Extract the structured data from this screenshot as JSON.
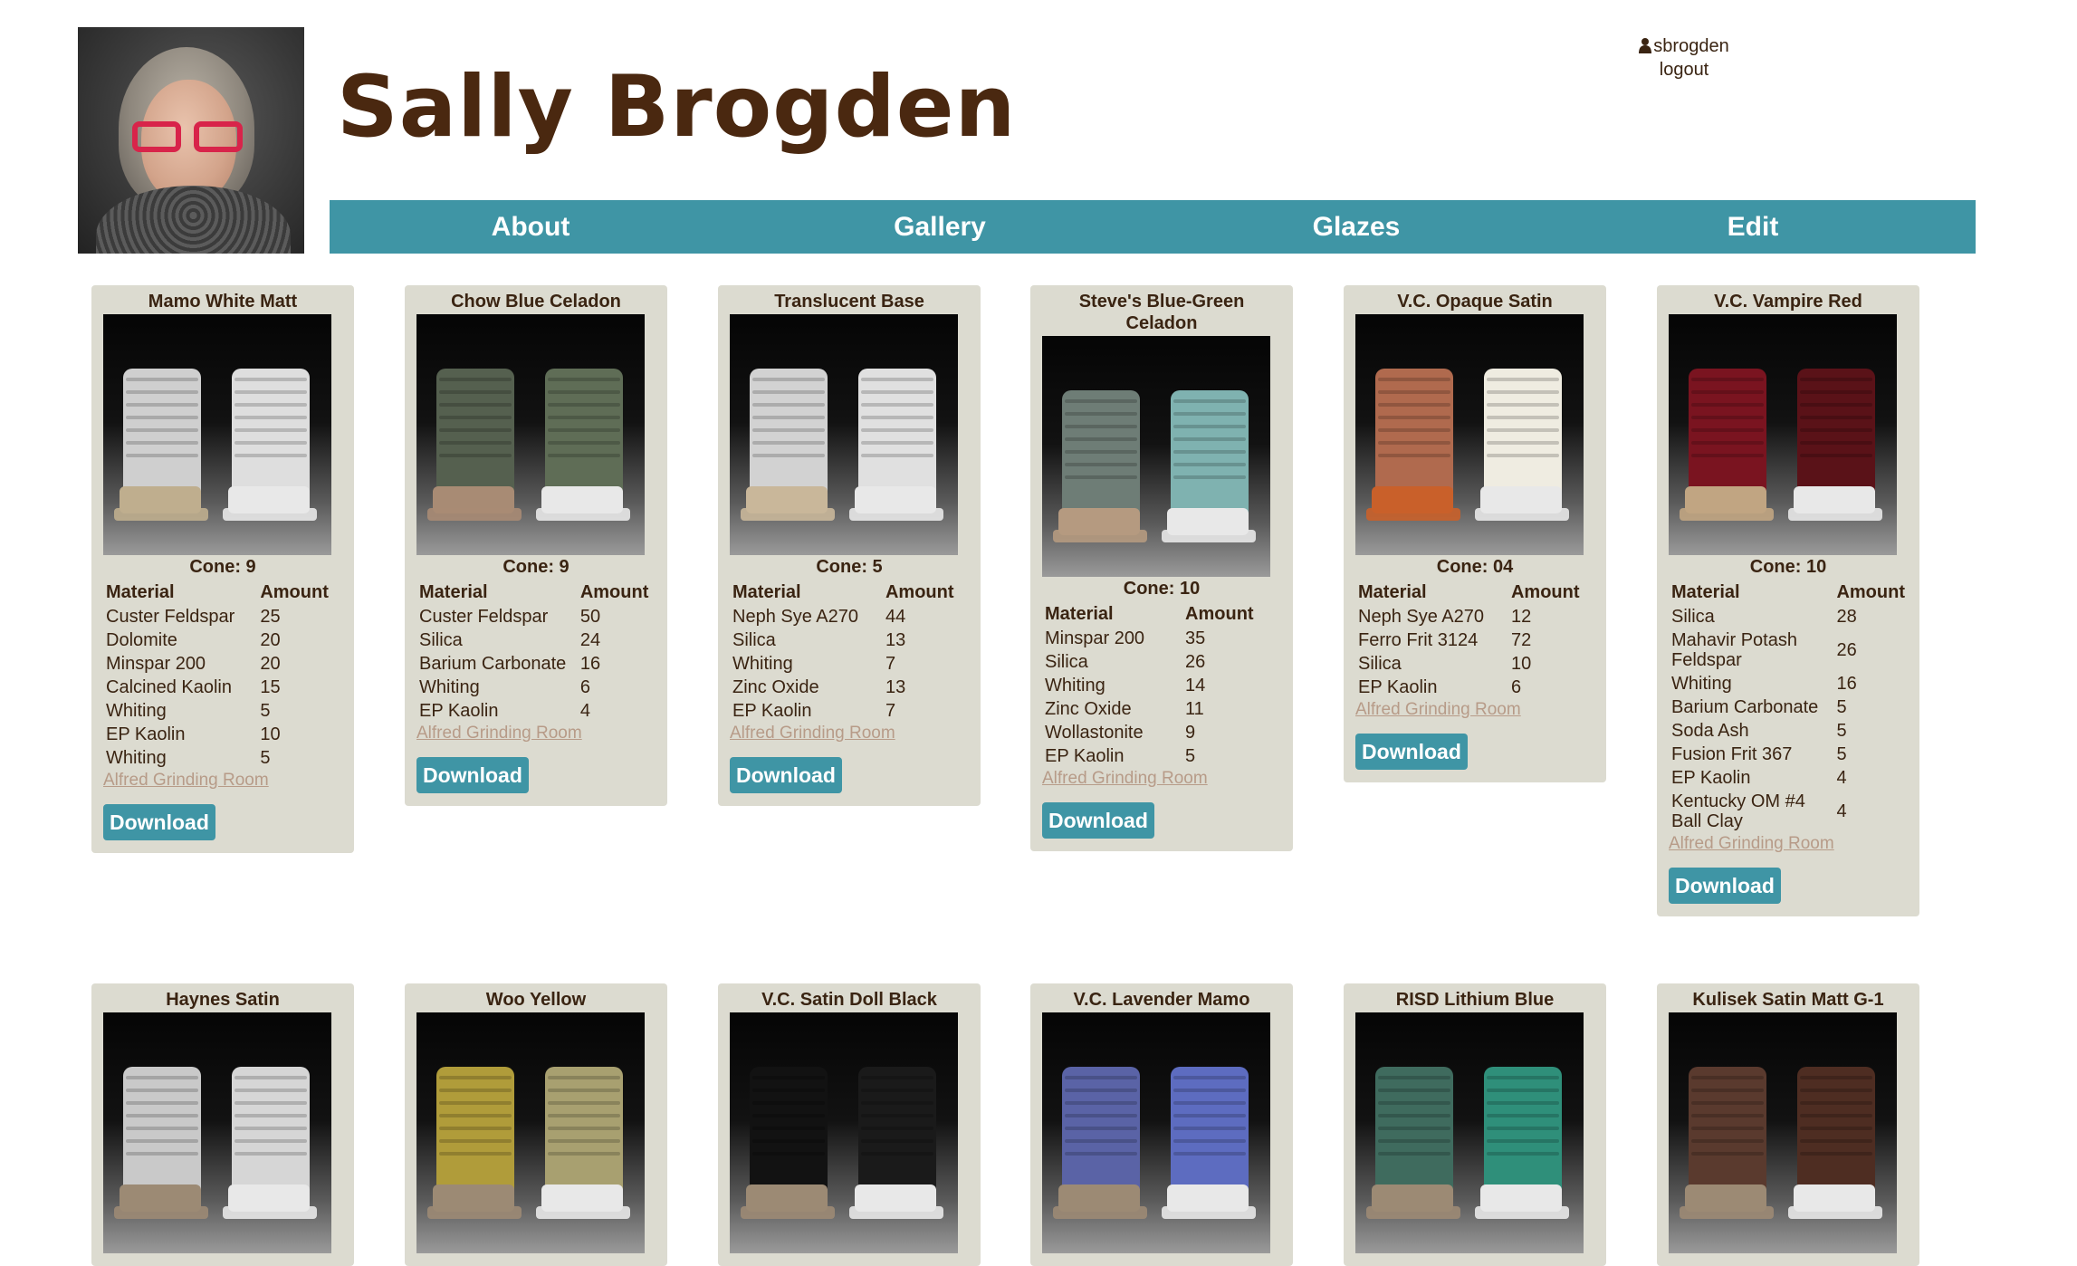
{
  "header": {
    "site_title": "Sally Brogden",
    "username": "sbrogden",
    "logout_label": "logout"
  },
  "nav": {
    "items": [
      "About",
      "Gallery",
      "Glazes",
      "Edit"
    ]
  },
  "colors": {
    "brand": "#4a2810",
    "nav_bg": "#3f95a5",
    "card_bg": "#dcdbd0",
    "link_muted": "#b79b88"
  },
  "labels": {
    "material": "Material",
    "amount": "Amount",
    "download": "Download"
  },
  "cards": [
    {
      "name": "Mamo White Matt",
      "cone": "Cone: 9",
      "swatch": [
        "#cfcfcf",
        "#dedede"
      ],
      "base": "#bfae8e",
      "rows": [
        [
          "Custer Feldspar",
          "25"
        ],
        [
          "Dolomite",
          "20"
        ],
        [
          "Minspar 200",
          "20"
        ],
        [
          "Calcined Kaolin",
          "15"
        ],
        [
          "Whiting",
          "5"
        ],
        [
          "EP Kaolin",
          "10"
        ],
        [
          "Whiting",
          "5"
        ]
      ],
      "source": "Alfred Grinding Room"
    },
    {
      "name": "Chow Blue Celadon",
      "cone": "Cone: 9",
      "swatch": [
        "#55604f",
        "#5f6d56"
      ],
      "base": "#a88b74",
      "rows": [
        [
          "Custer Feldspar",
          "50"
        ],
        [
          "Silica",
          "24"
        ],
        [
          "Barium Carbonate",
          "16"
        ],
        [
          "Whiting",
          "6"
        ],
        [
          "EP Kaolin",
          "4"
        ]
      ],
      "source": "Alfred Grinding Room"
    },
    {
      "name": "Translucent Base",
      "cone": "Cone: 5",
      "swatch": [
        "#d2d2d2",
        "#e0e0e0"
      ],
      "base": "#c9b79a",
      "rows": [
        [
          "Neph Sye A270",
          "44"
        ],
        [
          "Silica",
          "13"
        ],
        [
          "Whiting",
          "7"
        ],
        [
          "Zinc Oxide",
          "13"
        ],
        [
          "EP Kaolin",
          "7"
        ]
      ],
      "source": "Alfred Grinding Room"
    },
    {
      "name": "Steve's Blue-Green Celadon",
      "cone": "Cone: 10",
      "swatch": [
        "#6e7d76",
        "#7fb2b0"
      ],
      "base": "#b59a80",
      "rows": [
        [
          "Minspar 200",
          "35"
        ],
        [
          "Silica",
          "26"
        ],
        [
          "Whiting",
          "14"
        ],
        [
          "Zinc Oxide",
          "11"
        ],
        [
          "Wollastonite",
          "9"
        ],
        [
          "EP Kaolin",
          "5"
        ]
      ],
      "source": "Alfred Grinding Room"
    },
    {
      "name": "V.C. Opaque Satin",
      "cone": "Cone: 04",
      "swatch": [
        "#b06a4e",
        "#efece1"
      ],
      "base": "#c9602a",
      "rows": [
        [
          "Neph Sye A270",
          "12"
        ],
        [
          "Ferro Frit 3124",
          "72"
        ],
        [
          "Silica",
          "10"
        ],
        [
          "EP Kaolin",
          "6"
        ]
      ],
      "source": "Alfred Grinding Room"
    },
    {
      "name": "V.C. Vampire Red",
      "cone": "Cone: 10",
      "swatch": [
        "#7a1420",
        "#5a1218"
      ],
      "base": "#c1a582",
      "rows": [
        [
          "Silica",
          "28"
        ],
        [
          "Mahavir Potash Feldspar",
          "26"
        ],
        [
          "Whiting",
          "16"
        ],
        [
          "Barium Carbonate",
          "5"
        ],
        [
          "Soda Ash",
          "5"
        ],
        [
          "Fusion Frit 367",
          "5"
        ],
        [
          "EP Kaolin",
          "4"
        ],
        [
          "Kentucky OM #4 Ball Clay",
          "4"
        ]
      ],
      "source": "Alfred Grinding Room"
    },
    {
      "name": "Haynes Satin",
      "swatch": [
        "#c9c9c9",
        "#d6d6d6"
      ]
    },
    {
      "name": "Woo Yellow",
      "swatch": [
        "#b09c3a",
        "#a8a070"
      ]
    },
    {
      "name": "V.C. Satin Doll Black",
      "swatch": [
        "#121212",
        "#1a1a1a"
      ]
    },
    {
      "name": "V.C. Lavender Mamo",
      "swatch": [
        "#5a63a6",
        "#5d6cc0"
      ]
    },
    {
      "name": "RISD Lithium Blue",
      "swatch": [
        "#3f6b5e",
        "#2f8f7a"
      ]
    },
    {
      "name": "Kulisek Satin Matt G-1",
      "swatch": [
        "#5a3a2e",
        "#4e2d22"
      ]
    }
  ]
}
